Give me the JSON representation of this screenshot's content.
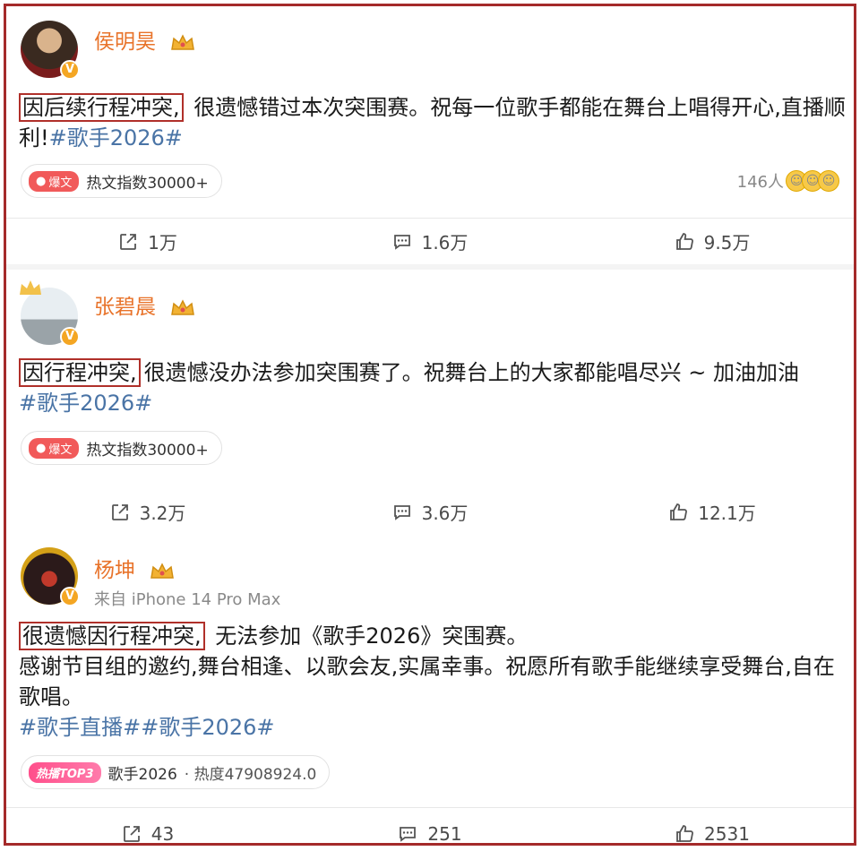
{
  "posts": [
    {
      "author": "侯明昊",
      "highlight": "因后续行程冲突,",
      "text": " 很遗憾错过本次突围赛。祝每一位歌手都能在舞台上唱得开心,直播顺利!",
      "tags": "#歌手2026#",
      "hot_badge": "爆文",
      "hot_label": "热文指数30000+",
      "reactions_count": "146人",
      "share": "1万",
      "comment": "1.6万",
      "like": "9.5万"
    },
    {
      "author": "张碧晨",
      "highlight": "因行程冲突,",
      "text": "很遗憾没办法参加突围赛了。祝舞台上的大家都能唱尽兴 ~ 加油加油",
      "tags": "#歌手2026#",
      "hot_badge": "爆文",
      "hot_label": "热文指数30000+",
      "share": "3.2万",
      "comment": "3.6万",
      "like": "12.1万"
    },
    {
      "author": "杨坤",
      "source": "来自 iPhone 14 Pro Max",
      "highlight": "很遗憾因行程冲突,",
      "text": " 无法参加《歌手2026》突围赛。\n感谢节目组的邀约,舞台相逢、以歌会友,实属幸事。祝愿所有歌手能继续享受舞台,自在歌唱。",
      "tags": "#歌手直播##歌手2026#",
      "hot_badge": "热播TOP3",
      "hot_label": "歌手2026",
      "hot_sub": "· 热度47908924.0",
      "share": "43",
      "comment": "251",
      "like": "2531"
    }
  ],
  "colors": {
    "frame": "#a42a2a",
    "author": "#e8732a",
    "hashtag": "#4a74a6",
    "highlight_box": "#b0302a"
  }
}
